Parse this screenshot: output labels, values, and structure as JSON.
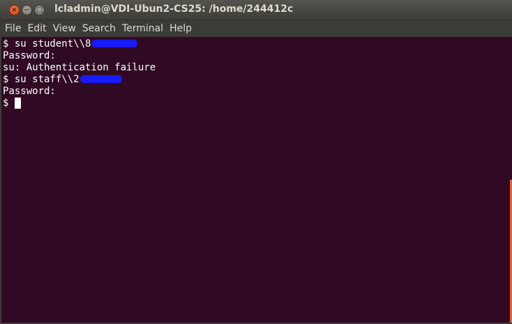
{
  "window": {
    "title": "lcladmin@VDI-Ubun2-CS25: /home/244412c",
    "close_glyph": "×",
    "minimize_glyph": "−",
    "maximize_glyph": "□"
  },
  "menubar": {
    "items": [
      "File",
      "Edit",
      "View",
      "Search",
      "Terminal",
      "Help"
    ]
  },
  "terminal": {
    "lines": [
      {
        "text": "$ su student\\\\8",
        "redacted": true
      },
      {
        "text": "Password:"
      },
      {
        "text": "su: Authentication failure"
      },
      {
        "text": "$ su staff\\\\2",
        "redacted": true
      },
      {
        "text": "Password:"
      },
      {
        "text": "$ ",
        "cursor": true
      }
    ]
  },
  "colors": {
    "terminal_bg": "#300a24",
    "terminal_fg": "#ffffff",
    "redaction": "#1a1aff",
    "scroll_thumb": "#e0643a"
  },
  "icons": {
    "close": "close-icon",
    "minimize": "minimize-icon",
    "maximize": "maximize-icon"
  }
}
